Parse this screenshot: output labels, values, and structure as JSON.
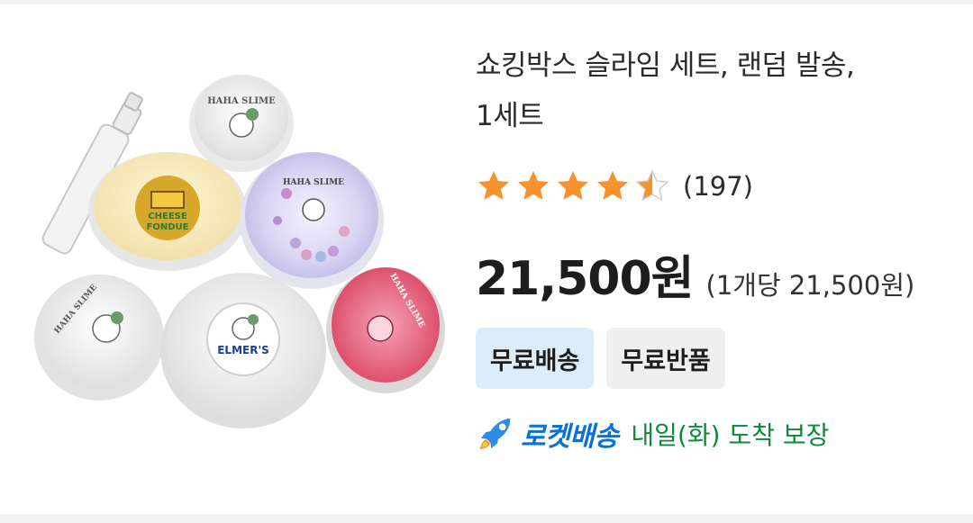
{
  "product": {
    "title_line1": "쇼킹박스 슬라임 세트, 랜덤 발송,",
    "title_line2": "1세트",
    "rating": 4.5,
    "rating_max": 5,
    "review_count": "(197)",
    "price": "21,500원",
    "unit_price": "(1개당 21,500원)"
  },
  "badges": {
    "free_shipping": "무료배송",
    "free_return": "무료반품"
  },
  "delivery": {
    "rocket_label": "로켓배송",
    "eta": "내일(화) 도착 보장"
  },
  "image": {
    "slime_brand": "HAHA SLIME",
    "cheese_label_1": "CHEESE",
    "cheese_label_2": "FONDUE",
    "elmers_label": "ELMER'S"
  },
  "colors": {
    "star": "#f8922e",
    "rocket_blue": "#0a71d6",
    "delivery_green": "#0a8a3a",
    "badge_blue": "#dcecf8",
    "badge_gray": "#efefef"
  },
  "icons": [
    "star-icon",
    "half-star-icon",
    "rocket-icon"
  ]
}
